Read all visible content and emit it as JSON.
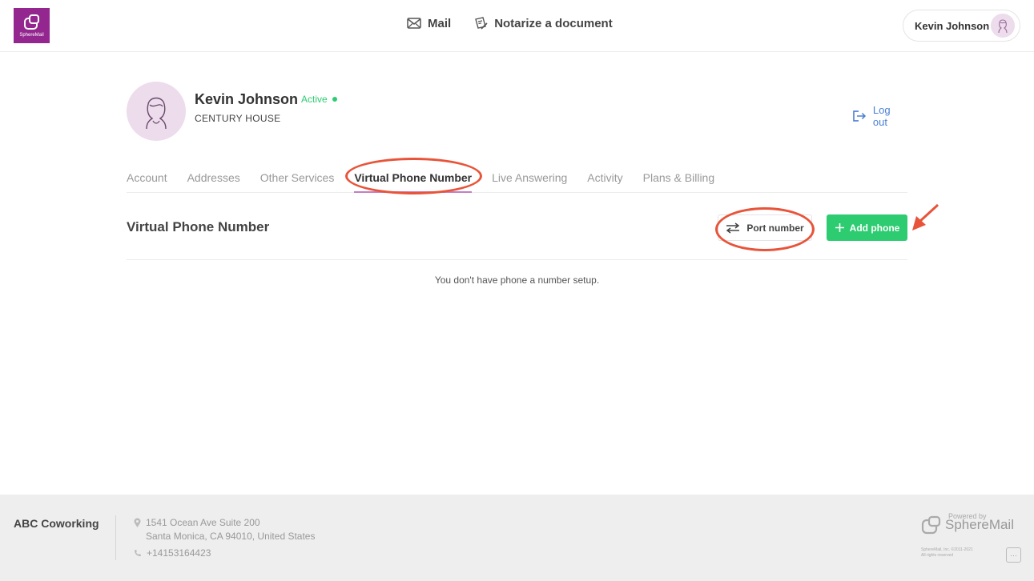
{
  "logo": {
    "text": "SphereMail"
  },
  "topnav": [
    {
      "label": "Mail",
      "icon": "mail-icon"
    },
    {
      "label": "Notarize a document",
      "icon": "notarize-icon"
    }
  ],
  "user_menu": {
    "name": "Kevin Johnson",
    "icon": "avatar-icon"
  },
  "profile": {
    "name": "Kevin Johnson",
    "status": "Active",
    "company": "CENTURY HOUSE",
    "logout_label": "Log out"
  },
  "tabs": [
    {
      "label": "Account"
    },
    {
      "label": "Addresses"
    },
    {
      "label": "Other Services"
    },
    {
      "label": "Virtual Phone Number",
      "active": true
    },
    {
      "label": "Live Answering"
    },
    {
      "label": "Activity"
    },
    {
      "label": "Plans & Billing"
    }
  ],
  "section": {
    "title": "Virtual Phone Number",
    "port_label": "Port number",
    "add_label": "Add phone",
    "empty_message": "You don't have phone a number setup."
  },
  "footer": {
    "brand": "ABC Coworking",
    "address_line1": "1541 Ocean Ave Suite 200",
    "address_line2": "Santa Monica, CA 94010, United States",
    "phone": "+14153164423",
    "powered_by": "Powered by",
    "spheremail": "SphereMail",
    "copyright_line1": "SphereMail, Inc. ©2011-2021",
    "copyright_line2": "All rights reserved",
    "chat_label": "···"
  },
  "colors": {
    "brand_purple": "#93278f",
    "accent_green": "#2ecc71",
    "link_blue": "#4a80d4",
    "annotation_red": "#e8543a"
  }
}
